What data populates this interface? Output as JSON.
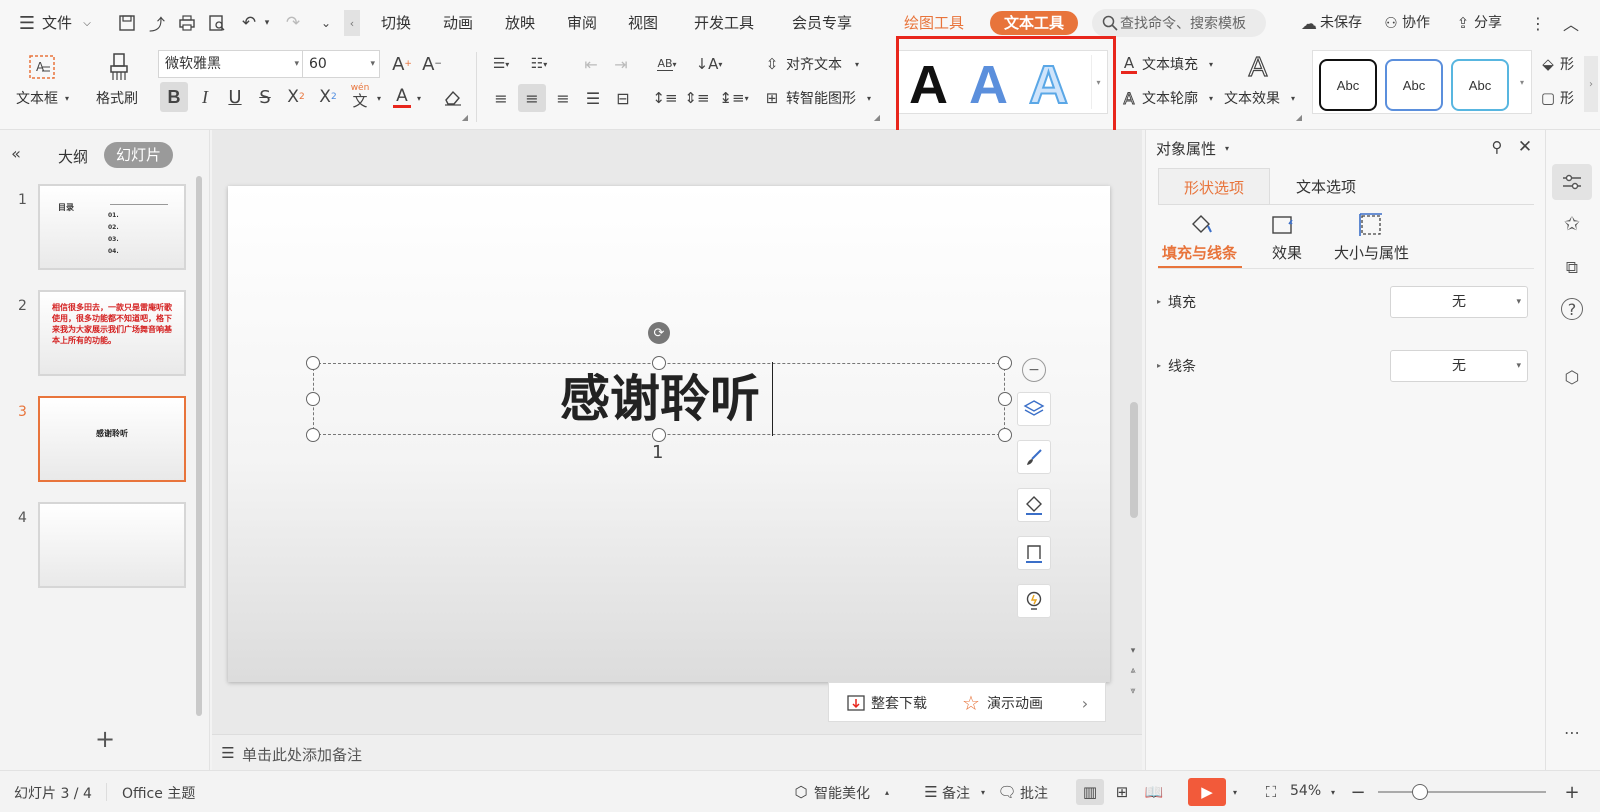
{
  "menubar": {
    "file": "文件",
    "tabs": [
      "切换",
      "动画",
      "放映",
      "审阅",
      "视图",
      "开发工具",
      "会员专享"
    ],
    "drawing_tools": "绘图工具",
    "text_tools": "文本工具",
    "search_placeholder": "查找命令、搜索模板",
    "unsaved": "未保存",
    "collaborate": "协作",
    "share": "分享"
  },
  "ribbon": {
    "textbox": "文本框",
    "format_painter": "格式刷",
    "font_name": "微软雅黑",
    "font_size": "60",
    "align_text": "对齐文本",
    "smart_shape": "转智能图形",
    "text_fill": "文本填充",
    "text_outline": "文本轮廓",
    "text_effect": "文本效果",
    "wen": "wén",
    "abc_styles": [
      "Abc",
      "Abc",
      "Abc"
    ],
    "shape_cut": "形"
  },
  "left_panel": {
    "outline_tab": "大纲",
    "slides_tab": "幻灯片",
    "slide_numbers": [
      "1",
      "2",
      "3",
      "4"
    ],
    "thumb1": {
      "title": "目录",
      "items": [
        "01.",
        "02.",
        "03.",
        "04."
      ]
    },
    "thumb2_text": "相信很多田去，一款只是雷庵听歌使用，很多功能都不知道吧，格下来我为大家展示我们广场舞音响基本上所有的功能。",
    "thumb3_text": "感谢聆听"
  },
  "slide": {
    "title": "感谢聆听",
    "page_number": "1"
  },
  "editor": {
    "download_all": "整套下载",
    "demo_animation": "演示动画",
    "notes_placeholder": "单击此处添加备注"
  },
  "right_panel": {
    "title": "对象属性",
    "tab_shape": "形状选项",
    "tab_text": "文本选项",
    "sub_fill_line": "填充与线条",
    "sub_effect": "效果",
    "sub_size": "大小与属性",
    "fill_label": "填充",
    "fill_value": "无",
    "line_label": "线条",
    "line_value": "无"
  },
  "statusbar": {
    "slide_info": "幻灯片 3 / 4",
    "theme": "Office 主题",
    "smart_beautify": "智能美化",
    "notes": "备注",
    "comments": "批注",
    "zoom": "54%"
  },
  "colors": {
    "accent_orange": "#e8743b",
    "highlight_red": "#e8261c",
    "style_blue": "#4f8de0"
  }
}
